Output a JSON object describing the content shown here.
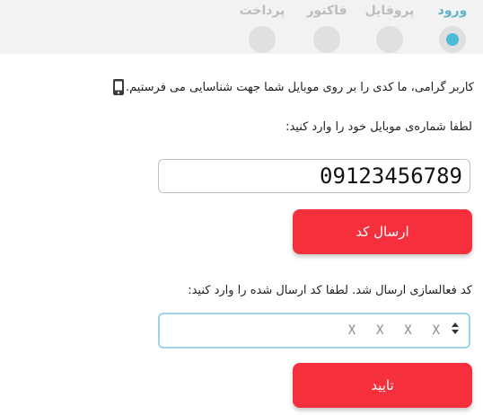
{
  "steps": [
    {
      "label": "ورود",
      "active": true
    },
    {
      "label": "پروفایل",
      "active": false
    },
    {
      "label": "فاکتور",
      "active": false
    },
    {
      "label": "پرداخت",
      "active": false
    }
  ],
  "info": {
    "icon": "mobile-icon",
    "text": "کاربر گرامی، ما کدی را بر روی موبایل شما جهت شناسایی می فرستیم."
  },
  "mobile": {
    "label": "لطفا شماره‌ی موبایل خود را وارد کنید:",
    "value": "09123456789"
  },
  "send_button": {
    "label": "ارسال کد"
  },
  "code": {
    "label": "کد فعالسازی ارسال شد. لطفا کد ارسال شده را وارد کنید:",
    "placeholder": "X  X  X  X"
  },
  "confirm_button": {
    "label": "تایید"
  },
  "colors": {
    "accent": "#f5303c",
    "active_step": "#4eb9d8",
    "inactive_step": "#e0e0e0",
    "topbar": "#f2f2f2"
  }
}
